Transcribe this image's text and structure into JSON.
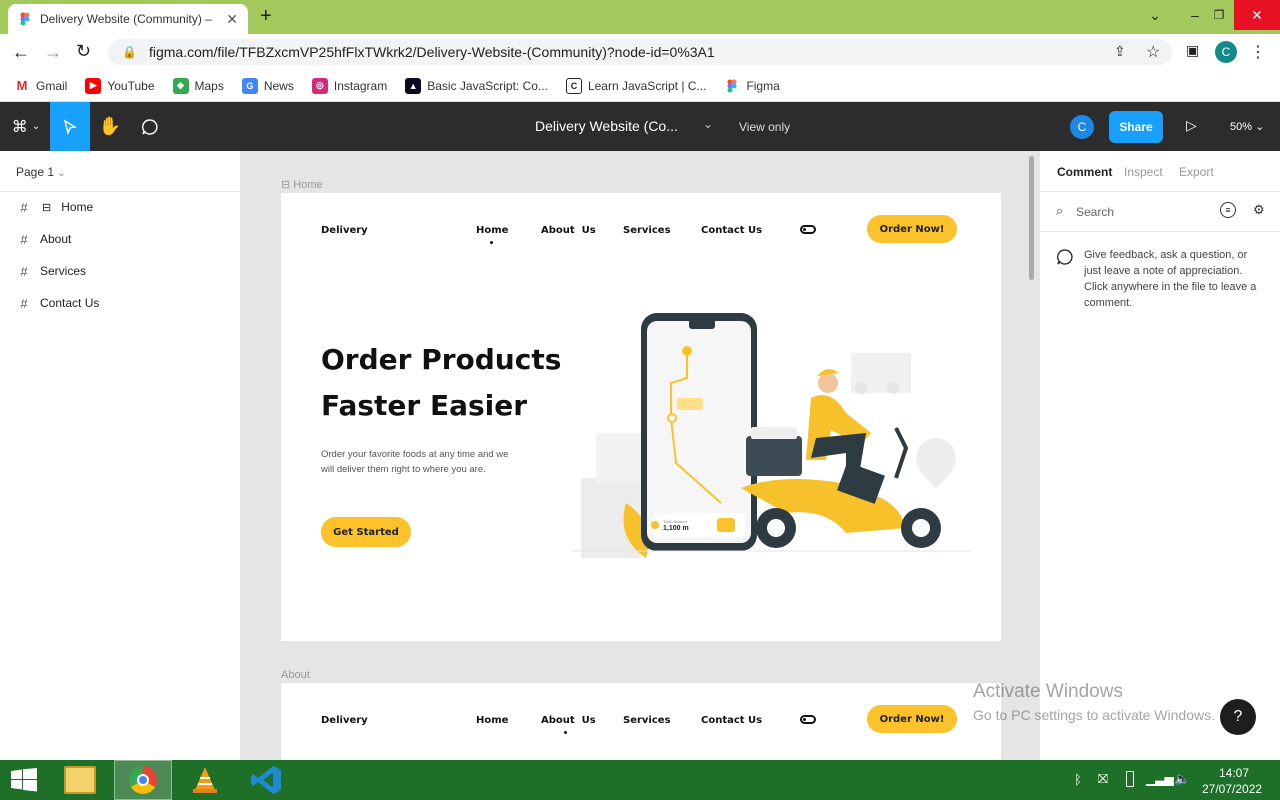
{
  "browser": {
    "tab_title": "Delivery Website (Community) –",
    "url": "figma.com/file/TFBZxcmVP25hfFlxTWkrk2/Delivery-Website-(Community)?node-id=0%3A1",
    "profile_initial": "C",
    "bookmarks": [
      "Gmail",
      "YouTube",
      "Maps",
      "News",
      "Instagram",
      "Basic JavaScript: Co...",
      "Learn JavaScript | C...",
      "Figma"
    ]
  },
  "figma": {
    "file_title": "Delivery Website (Co...",
    "view_mode": "View only",
    "avatar_initial": "C",
    "share_label": "Share",
    "zoom": "50%",
    "page": "Page 1",
    "layers": [
      "Home",
      "About",
      "Services",
      "Contact Us"
    ],
    "right_tabs": [
      "Comment",
      "Inspect",
      "Export"
    ],
    "search_placeholder": "Search",
    "comment_hint": "Give feedback, ask a question, or just leave a note of appreciation. Click anywhere in the file to leave a comment."
  },
  "canvas": {
    "frame1_label": "Home",
    "frame2_label": "About",
    "site": {
      "logo": "Delivery",
      "nav": [
        "Home",
        "About  Us",
        "Services",
        "Contact Us"
      ],
      "order_btn": "Order Now!",
      "headline_1": "Order Products",
      "headline_2": "Faster Easier",
      "subtext": "Order your favorite foods at any time and we will deliver them right to where you are.",
      "cta": "Get Started",
      "distance_label": "Total distance",
      "distance": "1,100 m"
    }
  },
  "watermark": {
    "title": "Activate Windows",
    "subtitle": "Go to PC settings to activate Windows."
  },
  "help": "?",
  "taskbar": {
    "time": "14:07",
    "date": "27/07/2022"
  }
}
